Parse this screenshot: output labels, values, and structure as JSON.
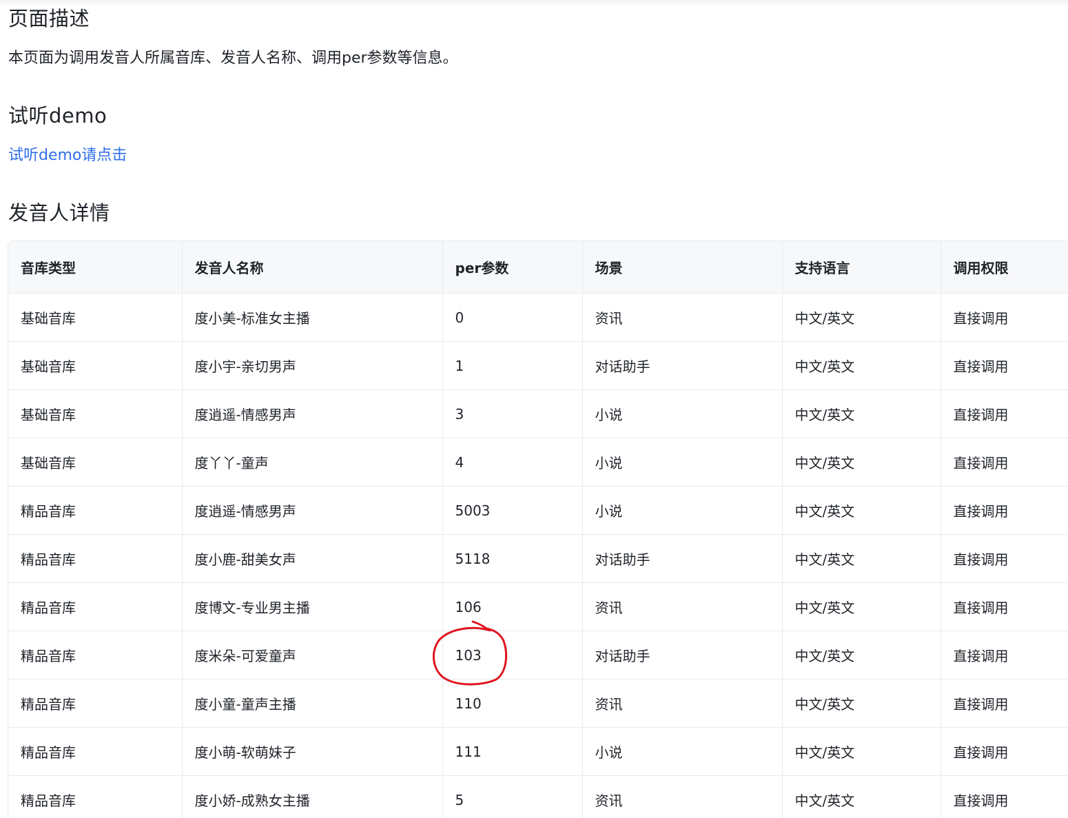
{
  "sections": {
    "description_title": "页面描述",
    "description_text": "本页面为调用发音人所属音库、发音人名称、调用per参数等信息。",
    "demo_title": "试听demo",
    "demo_link": "试听demo请点击",
    "detail_title": "发音人详情"
  },
  "table": {
    "headers": [
      "音库类型",
      "发音人名称",
      "per参数",
      "场景",
      "支持语言",
      "调用权限"
    ],
    "rows": [
      [
        "基础音库",
        "度小美-标准女主播",
        "0",
        "资讯",
        "中文/英文",
        "直接调用"
      ],
      [
        "基础音库",
        "度小宇-亲切男声",
        "1",
        "对话助手",
        "中文/英文",
        "直接调用"
      ],
      [
        "基础音库",
        "度逍遥-情感男声",
        "3",
        "小说",
        "中文/英文",
        "直接调用"
      ],
      [
        "基础音库",
        "度丫丫-童声",
        "4",
        "小说",
        "中文/英文",
        "直接调用"
      ],
      [
        "精品音库",
        "度逍遥-情感男声",
        "5003",
        "小说",
        "中文/英文",
        "直接调用"
      ],
      [
        "精品音库",
        "度小鹿-甜美女声",
        "5118",
        "对话助手",
        "中文/英文",
        "直接调用"
      ],
      [
        "精品音库",
        "度博文-专业男主播",
        "106",
        "资讯",
        "中文/英文",
        "直接调用"
      ],
      [
        "精品音库",
        "度米朵-可爱童声",
        "103",
        "对话助手",
        "中文/英文",
        "直接调用"
      ],
      [
        "精品音库",
        "度小童-童声主播",
        "110",
        "资讯",
        "中文/英文",
        "直接调用"
      ],
      [
        "精品音库",
        "度小萌-软萌妹子",
        "111",
        "小说",
        "中文/英文",
        "直接调用"
      ],
      [
        "精品音库",
        "度小娇-成熟女主播",
        "5",
        "资讯",
        "中文/英文",
        "直接调用"
      ]
    ]
  },
  "annotation": {
    "color": "#e0141e",
    "circled_value": "103"
  }
}
